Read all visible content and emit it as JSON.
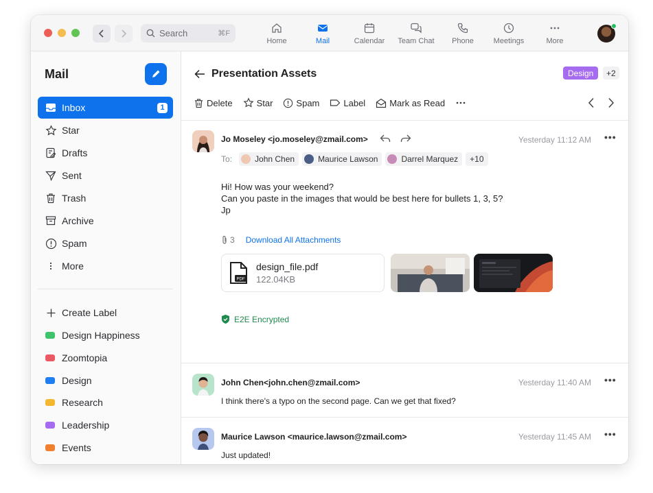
{
  "titlebar": {
    "search_placeholder": "Search",
    "search_shortcut": "⌘F",
    "nav": [
      {
        "label": "Home",
        "icon": "home-icon"
      },
      {
        "label": "Mail",
        "icon": "mail-icon",
        "active": true
      },
      {
        "label": "Calendar",
        "icon": "calendar-icon"
      },
      {
        "label": "Team Chat",
        "icon": "chat-icon"
      },
      {
        "label": "Phone",
        "icon": "phone-icon"
      },
      {
        "label": "Meetings",
        "icon": "clock-icon"
      },
      {
        "label": "More",
        "icon": "more-icon"
      }
    ]
  },
  "sidebar": {
    "title": "Mail",
    "folders": [
      {
        "label": "Inbox",
        "icon": "inbox-icon",
        "badge": "1",
        "active": true
      },
      {
        "label": "Star",
        "icon": "star-icon"
      },
      {
        "label": "Drafts",
        "icon": "drafts-icon"
      },
      {
        "label": "Sent",
        "icon": "sent-icon"
      },
      {
        "label": "Trash",
        "icon": "trash-icon"
      },
      {
        "label": "Archive",
        "icon": "archive-icon"
      },
      {
        "label": "Spam",
        "icon": "spam-icon"
      },
      {
        "label": "More",
        "icon": "more-vertical-icon"
      }
    ],
    "create_label": "Create Label",
    "labels": [
      {
        "label": "Design Happiness",
        "color": "#3fc46c"
      },
      {
        "label": "Zoomtopia",
        "color": "#eb5a63"
      },
      {
        "label": "Design",
        "color": "#1f7ef2"
      },
      {
        "label": "Research",
        "color": "#f5b731"
      },
      {
        "label": "Leadership",
        "color": "#a66cf0"
      },
      {
        "label": "Events",
        "color": "#f07f2e"
      }
    ]
  },
  "thread": {
    "subject": "Presentation Assets",
    "tag": "Design",
    "tag_more": "+2",
    "toolbar": {
      "delete": "Delete",
      "star": "Star",
      "spam": "Spam",
      "label": "Label",
      "mark_read": "Mark as Read"
    },
    "first": {
      "sender": "Jo Moseley <jo.moseley@zmail.com>",
      "time": "Yesterday 11:12 AM",
      "to_label": "To:",
      "recipients": [
        "John Chen",
        "Maurice Lawson",
        "Darrel Marquez"
      ],
      "recipients_more": "+10",
      "body": [
        "Hi! How was your weekend?",
        "Can you paste in the images that would be best here for bullets 1, 3, 5?",
        "Jp"
      ],
      "attach_count": "3",
      "download_all": "Download All Attachments",
      "file_name": "design_file.pdf",
      "file_size": "122.04KB",
      "file_badge": "PDF",
      "encrypted": "E2E Encrypted"
    },
    "replies": [
      {
        "sender": "John Chen<john.chen@zmail.com>",
        "time": "Yesterday 11:40 AM",
        "text": "I think there's a typo on the second page. Can we get that fixed?"
      },
      {
        "sender": "Maurice Lawson <maurice.lawson@zmail.com>",
        "time": "Yesterday 11:45 AM",
        "text": "Just updated!"
      }
    ]
  },
  "colors": {
    "accent": "#0e72ed",
    "tag": "#a66cf0",
    "encrypted": "#1f8a4c"
  }
}
